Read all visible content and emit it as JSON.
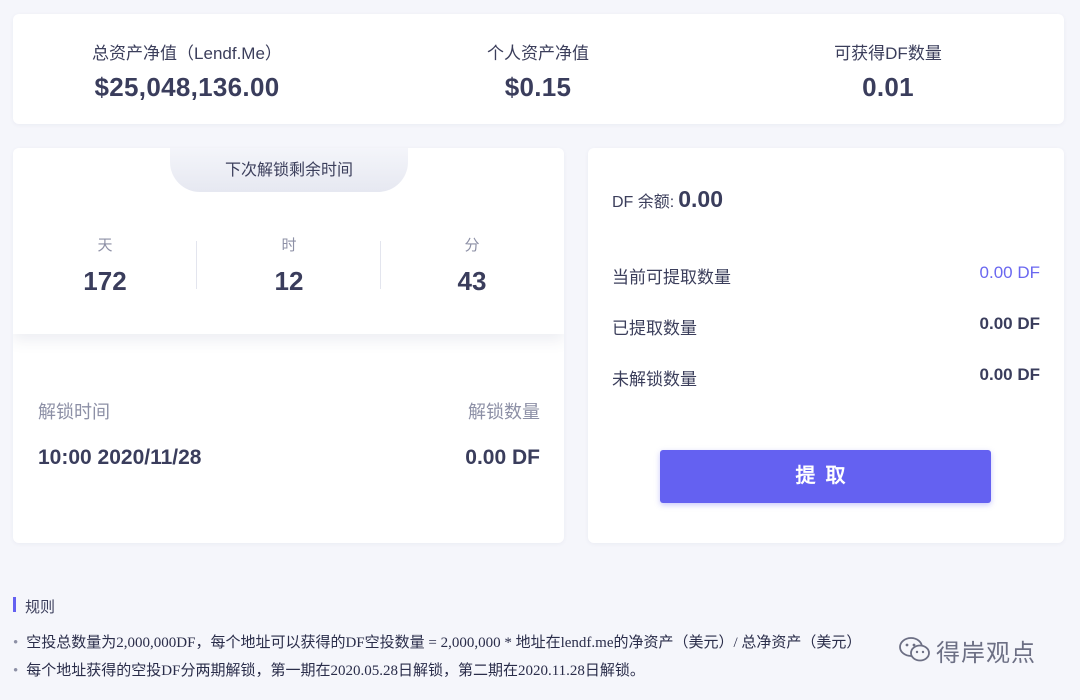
{
  "stats": [
    {
      "label": "总资产净值（Lendf.Me）",
      "value": "$25,048,136.00"
    },
    {
      "label": "个人资产净值",
      "value": "$0.15"
    },
    {
      "label": "可获得DF数量",
      "value": "0.01"
    }
  ],
  "countdown": {
    "title": "下次解锁剩余时间",
    "units": [
      {
        "unit": "天",
        "value": "172"
      },
      {
        "unit": "时",
        "value": "12"
      },
      {
        "unit": "分",
        "value": "43"
      }
    ]
  },
  "unlock": {
    "time_header": "解锁时间",
    "amount_header": "解锁数量",
    "time_value": "10:00 2020/11/28",
    "amount_value": "0.00 DF"
  },
  "balance": {
    "label": "DF 余额:",
    "value": "0.00",
    "rows": [
      {
        "label": "当前可提取数量",
        "value": "0.00 DF"
      },
      {
        "label": "已提取数量",
        "value": "0.00 DF"
      },
      {
        "label": "未解锁数量",
        "value": "0.00 DF"
      }
    ],
    "withdraw_label": "提取"
  },
  "rules": {
    "title": "规则",
    "items": [
      "空投总数量为2,000,000DF，每个地址可以获得的DF空投数量 = 2,000,000 * 地址在lendf.me的净资产（美元）/ 总净资产（美元）",
      "每个地址获得的空投DF分两期解锁，第一期在2020.05.28日解锁，第二期在2020.11.28日解锁。"
    ],
    "bullet": "•"
  },
  "watermark": {
    "text": "得岸观点",
    "icon": "wechat-icon"
  },
  "colors": {
    "accent": "#6461f1",
    "background": "#f5f6fb",
    "text": "#3a3d5c",
    "muted": "#8d90a6"
  }
}
